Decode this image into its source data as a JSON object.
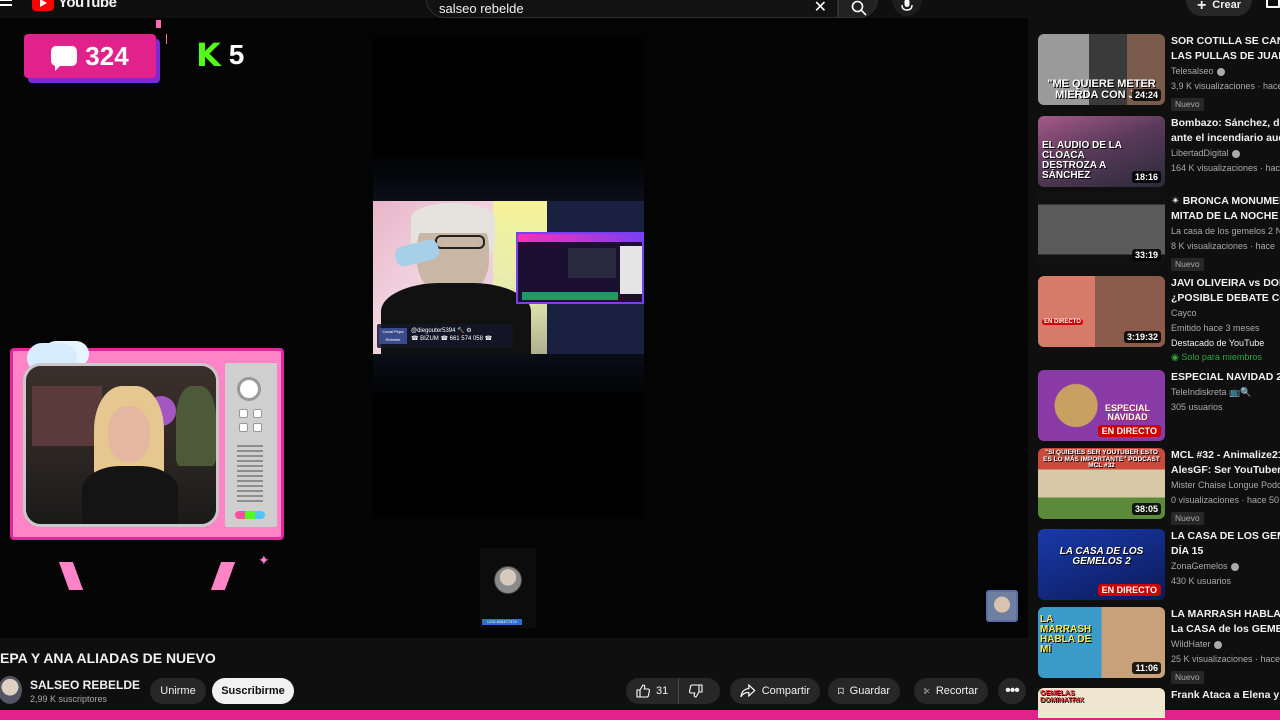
{
  "header": {
    "logo_text": "YouTube",
    "search_value": "salseo rebelde",
    "create_label": "Crear"
  },
  "stream": {
    "chat_count": "324",
    "kick_count": "5",
    "overlay_line": "@diegouter5394 🔨 ⚙",
    "overlay_line2": "☎ BIZUM ☎ 661 574 058 ☎",
    "overlay_tag": "Canal Pepa Rebelde",
    "avatar_tag": "LOU 636477474"
  },
  "video": {
    "title": "EPA Y ANA ALIADAS DE NUEVO",
    "channel_name": "SALSEO REBELDE",
    "subscribers": "2,99 K suscriptores",
    "join_label": "Unirme",
    "subscribe_label": "Suscribirme",
    "like_count": "31",
    "share_label": "Compartir",
    "save_label": "Guardar",
    "clip_label": "Recortar"
  },
  "recommendations": [
    {
      "title": "SOR COTILLA SE CANS",
      "title2": "LAS PULLAS DE JUAN.",
      "channel": "Telesalseo",
      "meta": "3,9 K visualizaciones · hace",
      "badge": "Nuevo",
      "duration": "24:24",
      "thumb_text": "\"ME QUIERE METER MIERDA CON JA\""
    },
    {
      "title": "Bombazo: Sánchez, des",
      "title2": "ante el incendiario audi",
      "channel": "LibertadDigital",
      "meta": "164 K visualizaciones · hace",
      "duration": "18:16",
      "thumb_text": "EL AUDIO DE LA CLOACA DESTROZA A SÁNCHEZ"
    },
    {
      "title": "✴ BRONCA MONUMEN",
      "title2": "MITAD DE LA NOCHE E",
      "channel": "La casa de los gemelos 2 N",
      "meta": "8 K visualizaciones · hace",
      "badge": "Nuevo",
      "duration": "33:19"
    },
    {
      "title": "JAVI OLIVEIRA vs DOK",
      "title2": "¿POSIBLE DEBATE CON",
      "channel": "Cayco",
      "meta": "Emitido hace 3 meses",
      "featured": "Destacado de YouTube",
      "members": "Solo para miembros",
      "duration": "3:19:32",
      "live_tag": "EN DIRECTO"
    },
    {
      "title": "ESPECIAL NAVIDAD 20",
      "channel": "TeleIndiskreta 📺🔍",
      "meta": "305 usuarios",
      "live": "EN DIRECTO",
      "thumb_text": "ESPECIAL NAVIDAD"
    },
    {
      "title": "MCL #32 - Animalize21",
      "title2": "AlesGF: Ser YouTuber p",
      "channel": "Mister Chaise Longue Podc",
      "meta": "0 visualizaciones · hace 50",
      "badge": "Nuevo",
      "duration": "38:05",
      "thumb_text": "\"SI QUIERES SER YOUTUBER ESTO ES LO MÁS IMPORTANTE\" PODCAST MCL #32"
    },
    {
      "title": "LA CASA DE LOS GEME",
      "title2": "DÍA 15",
      "channel": "ZonaGemelos",
      "meta": "430 K usuarios",
      "live": "EN DIRECTO",
      "thumb_text": "LA CASA DE LOS GEMELOS 2"
    },
    {
      "title": "LA MARRASH HABLA D",
      "title2": "La CASA de los GEMEL",
      "channel": "WildHater",
      "meta": "25 K visualizaciones · hace",
      "badge": "Nuevo",
      "duration": "11:06",
      "thumb_text": "LA MARRASH HABLA DE MÍ"
    },
    {
      "title": "Frank Ataca a Elena y A",
      "thumb_text": "GEMELAS DOMINATRIX"
    }
  ]
}
